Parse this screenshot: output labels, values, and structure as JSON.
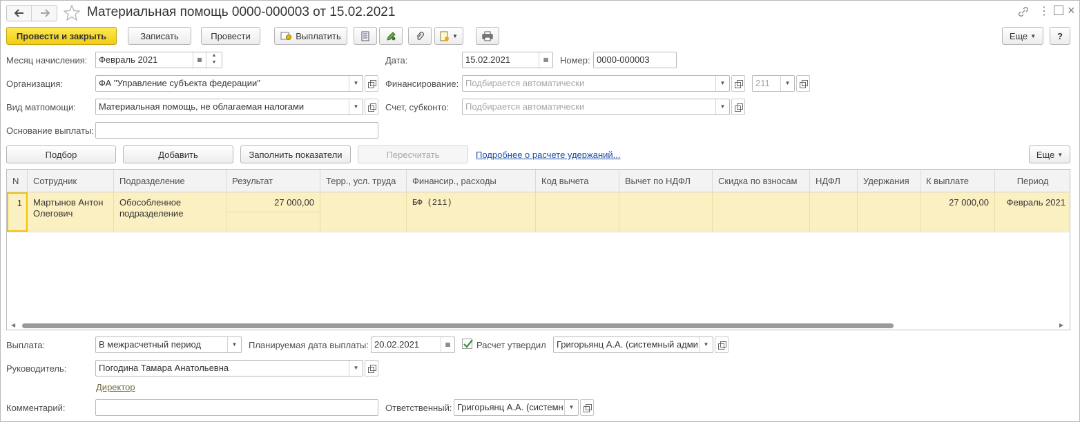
{
  "window": {
    "title": "Материальная помощь 0000-000003 от 15.02.2021"
  },
  "toolbar": {
    "post_close": "Провести и закрыть",
    "save": "Записать",
    "post": "Провести",
    "pay": "Выплатить",
    "more": "Еще",
    "help": "?"
  },
  "form": {
    "month_label": "Месяц начисления:",
    "month_value": "Февраль 2021",
    "date_label": "Дата:",
    "date_value": "15.02.2021",
    "number_label": "Номер:",
    "number_value": "0000-000003",
    "org_label": "Организация:",
    "org_value": "ФА \"Управление субъекта федерации\"",
    "financing_label": "Финансирование:",
    "financing_placeholder": "Подбирается автоматически",
    "kosgu_value": "211",
    "aid_type_label": "Вид матпомощи:",
    "aid_type_value": "Материальная помощь, не облагаемая налогами",
    "account_label": "Счет, субконто:",
    "account_placeholder": "Подбирается автоматически",
    "basis_label": "Основание выплаты:",
    "basis_value": ""
  },
  "table_toolbar": {
    "select": "Подбор",
    "add": "Добавить",
    "fill": "Заполнить показатели",
    "recalc": "Пересчитать",
    "details_link": "Подробнее о расчете удержаний...",
    "more": "Еще"
  },
  "table": {
    "columns": [
      "N",
      "Сотрудник",
      "Подразделение",
      "Результат",
      "Терр., усл. труда",
      "Финансир., расходы",
      "Код вычета",
      "Вычет по НДФЛ",
      "Скидка по взносам",
      "НДФЛ",
      "Удержания",
      "К выплате",
      "Период"
    ],
    "rows": [
      {
        "n": "1",
        "employee_line1": "Мартынов Антон",
        "employee_line2": "Олегович",
        "department_line1": "Обособленное",
        "department_line2": "подразделение",
        "result": "27 000,00",
        "terr": "",
        "financing": "БФ (211)",
        "deduction_code": "",
        "ndfl_deduction": "",
        "contrib_discount": "",
        "ndfl": "",
        "withholding": "",
        "to_pay": "27 000,00",
        "period": "Февраль 2021"
      }
    ]
  },
  "bottom": {
    "payout_label": "Выплата:",
    "payout_value": "В межрасчетный период",
    "planned_date_label": "Планируемая дата выплаты:",
    "planned_date_value": "20.02.2021",
    "approved_label": "Расчет утвердил",
    "approved_checked": true,
    "approved_by": "Григорьянц А.А. (системный адми",
    "manager_label": "Руководитель:",
    "manager_value": "Погодина Тамара Анатольевна",
    "manager_position": "Директор",
    "comment_label": "Комментарий:",
    "comment_value": "",
    "responsible_label": "Ответственный:",
    "responsible_value": "Григорьянц А.А. (системн"
  },
  "colors": {
    "primary_button": "#f5d123",
    "selected_row": "#fbf0c1",
    "link": "#1b4ea8"
  }
}
